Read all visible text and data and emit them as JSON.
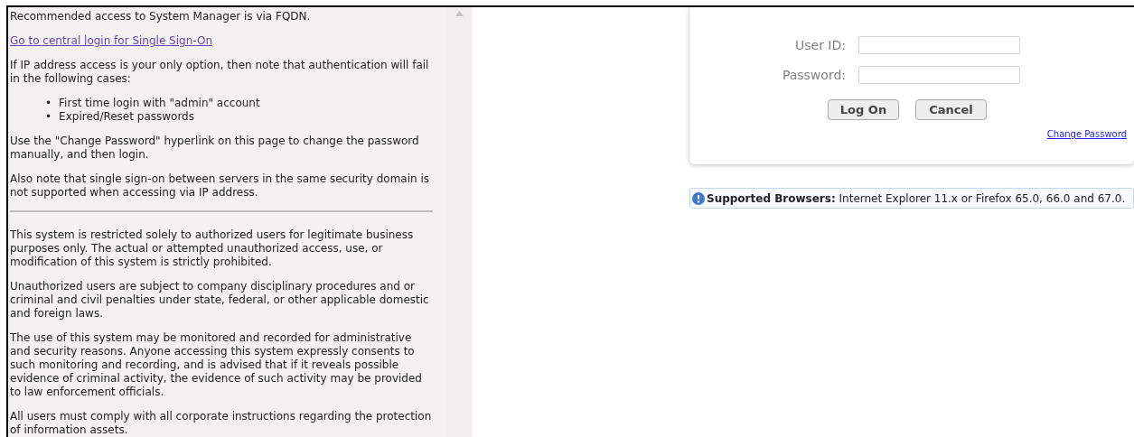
{
  "notice_panel": {
    "intro": "Recommended access to System Manager is via FQDN.",
    "sso_link": "Go to central login for Single Sign-On",
    "ip_warning": "If IP address access is your only option, then note that authentication will fail in the following cases:",
    "cases": [
      {
        "bullet": "•",
        "text": "First time login with \"admin\" account"
      },
      {
        "bullet": "•",
        "text": "Expired/Reset passwords"
      }
    ],
    "notes": [
      "Use the \"Change Password\" hyperlink on this page to change the password manually, and then login.",
      "Also note that single sign-on between servers in the same security domain is not supported when accessing via IP address."
    ],
    "legal": [
      "This system is restricted solely to authorized users for legitimate business purposes only. The actual or attempted unauthorized access, use, or modification of this system is strictly prohibited.",
      "Unauthorized users are subject to company disciplinary procedures and or criminal and civil penalties under state, federal, or other applicable domestic and foreign laws.",
      "The use of this system may be monitored and recorded for administrative and security reasons. Anyone accessing this system expressly consents to such monitoring and recording, and is advised that if it reveals possible evidence of criminal activity, the evidence of such activity may be provided to law enforcement officials.",
      "All users must comply with all corporate instructions regarding the protection of information assets."
    ]
  },
  "login_form": {
    "fields": [
      {
        "label": "User ID:"
      },
      {
        "label": "Password:"
      }
    ],
    "buttons": [
      "Log On",
      "Cancel"
    ],
    "change_password_link": "Change Password"
  },
  "supported_browsers": "**Supported Browsers:** Internet Explorer 11.x or Firefox 65.0, 66.0 and 67.0."
}
